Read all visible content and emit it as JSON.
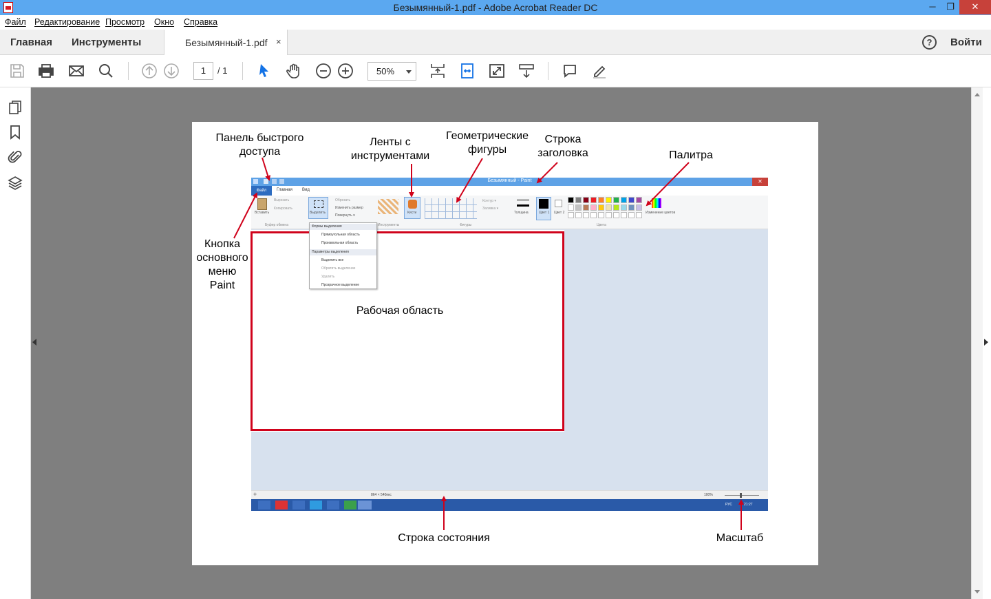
{
  "window": {
    "title": "Безымянный-1.pdf - Adobe Acrobat Reader DC",
    "min": "─",
    "max": "❐",
    "close": "✕"
  },
  "menu": [
    "Файл",
    "Редактирование",
    "Просмотр",
    "Окно",
    "Справка"
  ],
  "tabs": {
    "home": "Главная",
    "tools": "Инструменты",
    "document": "Безымянный-1.pdf",
    "close": "×",
    "help": "?",
    "signin": "Войти"
  },
  "toolbar": {
    "page_current": "1",
    "page_total": "/ 1",
    "zoom": "50%"
  },
  "page": {
    "labels": {
      "quick_access_1": "Панель быстрого",
      "quick_access_2": "доступа",
      "ribbons_1": "Ленты с",
      "ribbons_2": "инструментами",
      "shapes_1": "Геометрические",
      "shapes_2": "фигуры",
      "titlebar_1": "Строка",
      "titlebar_2": "заголовка",
      "palette": "Палитра",
      "menu_button_1": "Кнопка",
      "menu_button_2": "основного",
      "menu_button_3": "меню",
      "menu_button_4": "Paint",
      "workarea": "Рабочая область",
      "statusbar": "Строка состояния",
      "zoom": "Масштаб"
    }
  },
  "paint": {
    "title": "Безымянный - Paint",
    "tabs": [
      "Файл",
      "Главная",
      "Вид"
    ],
    "ribbon": {
      "paste": "Вставить",
      "cut": "Вырезать",
      "copy": "Копировать",
      "select": "Выделить",
      "crop": "Обрезать",
      "resize": "Изменить размер",
      "rotate": "Повернуть ▾",
      "brushes": "Кисти",
      "outline": "Контур ▾",
      "fill": "Заливка ▾",
      "thickness": "Толщина",
      "color1": "Цвет 1",
      "color2": "Цвет 2",
      "edit_colors": "Изменение цветов",
      "group_clipboard": "Буфер обмена",
      "group_tools": "Инструменты",
      "group_shapes": "Фигуры",
      "group_colors": "Цвета"
    },
    "dropdown": {
      "header1": "Формы выделения",
      "rect": "Прямоугольная область",
      "free": "Произвольная область",
      "header2": "Параметры выделения",
      "select_all": "Выделить все",
      "invert": "Обратить выделение",
      "delete": "Удалить",
      "transparent": "Прозрачное выделение"
    },
    "status": {
      "size": "864 × 540пкс",
      "zoom": "100%"
    },
    "taskbar": {
      "lang": "РУС",
      "time": "21:27"
    },
    "palette_colors": [
      "#000000",
      "#7f7f7f",
      "#880015",
      "#ed1c24",
      "#ff7f27",
      "#fff200",
      "#22b14c",
      "#00a2e8",
      "#3f48cc",
      "#a349a4",
      "#ffffff",
      "#c3c3c3",
      "#b97a57",
      "#ffaec9",
      "#ffc90e",
      "#efe4b0",
      "#b5e61d",
      "#99d9ea",
      "#7092be",
      "#c8bfe7"
    ]
  },
  "colors": {
    "accent_blue": "#5ba8f0",
    "annotation_red": "#d0021b"
  }
}
